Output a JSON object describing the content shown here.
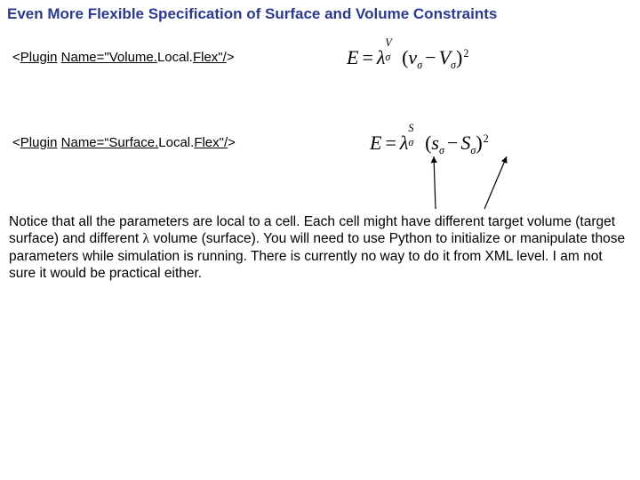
{
  "title": "Even More Flexible Specification of Surface and Volume Constraints",
  "plugins": {
    "volume": {
      "prefix": "<",
      "kw1": "Plugin",
      "mid": " ",
      "kw2": "Name=\"Volume.",
      "rest": "Local.",
      "kw3": "Flex\"/",
      "suffix": ">"
    },
    "surface": {
      "prefix": "<",
      "kw1": "Plugin",
      "mid": " ",
      "kw2": "Name=“Surface.",
      "rest": "Local.",
      "kw3": "Flex\"/",
      "suffix": ">"
    }
  },
  "formula1": {
    "E": "E",
    "eq": "=",
    "lambda": "λ",
    "sup": "V",
    "sub": "σ",
    "lparen": "(",
    "v": "ν",
    "vsub": "σ",
    "minus": "−",
    "V": "V",
    "Vsub": "σ",
    "rparen": ")",
    "exp": "2"
  },
  "formula2": {
    "E": "E",
    "eq": "=",
    "lambda": "λ",
    "sup": "S",
    "sub": "σ",
    "lparen": "(",
    "s": "s",
    "ssub": "σ",
    "minus": "−",
    "S": "S",
    "Ssub": "σ",
    "rparen": ")",
    "exp": "2"
  },
  "body": {
    "p1a": "Notice that all the parameters are local to a cell. Each cell might have different target volume (target surface) and different ",
    "lambda": "λ",
    "p1b": " volume (surface). You will need to use Python to initialize or manipulate those parameters while simulation is running. There is currently no way to do it from XML level. I am not sure it would be practical either."
  }
}
